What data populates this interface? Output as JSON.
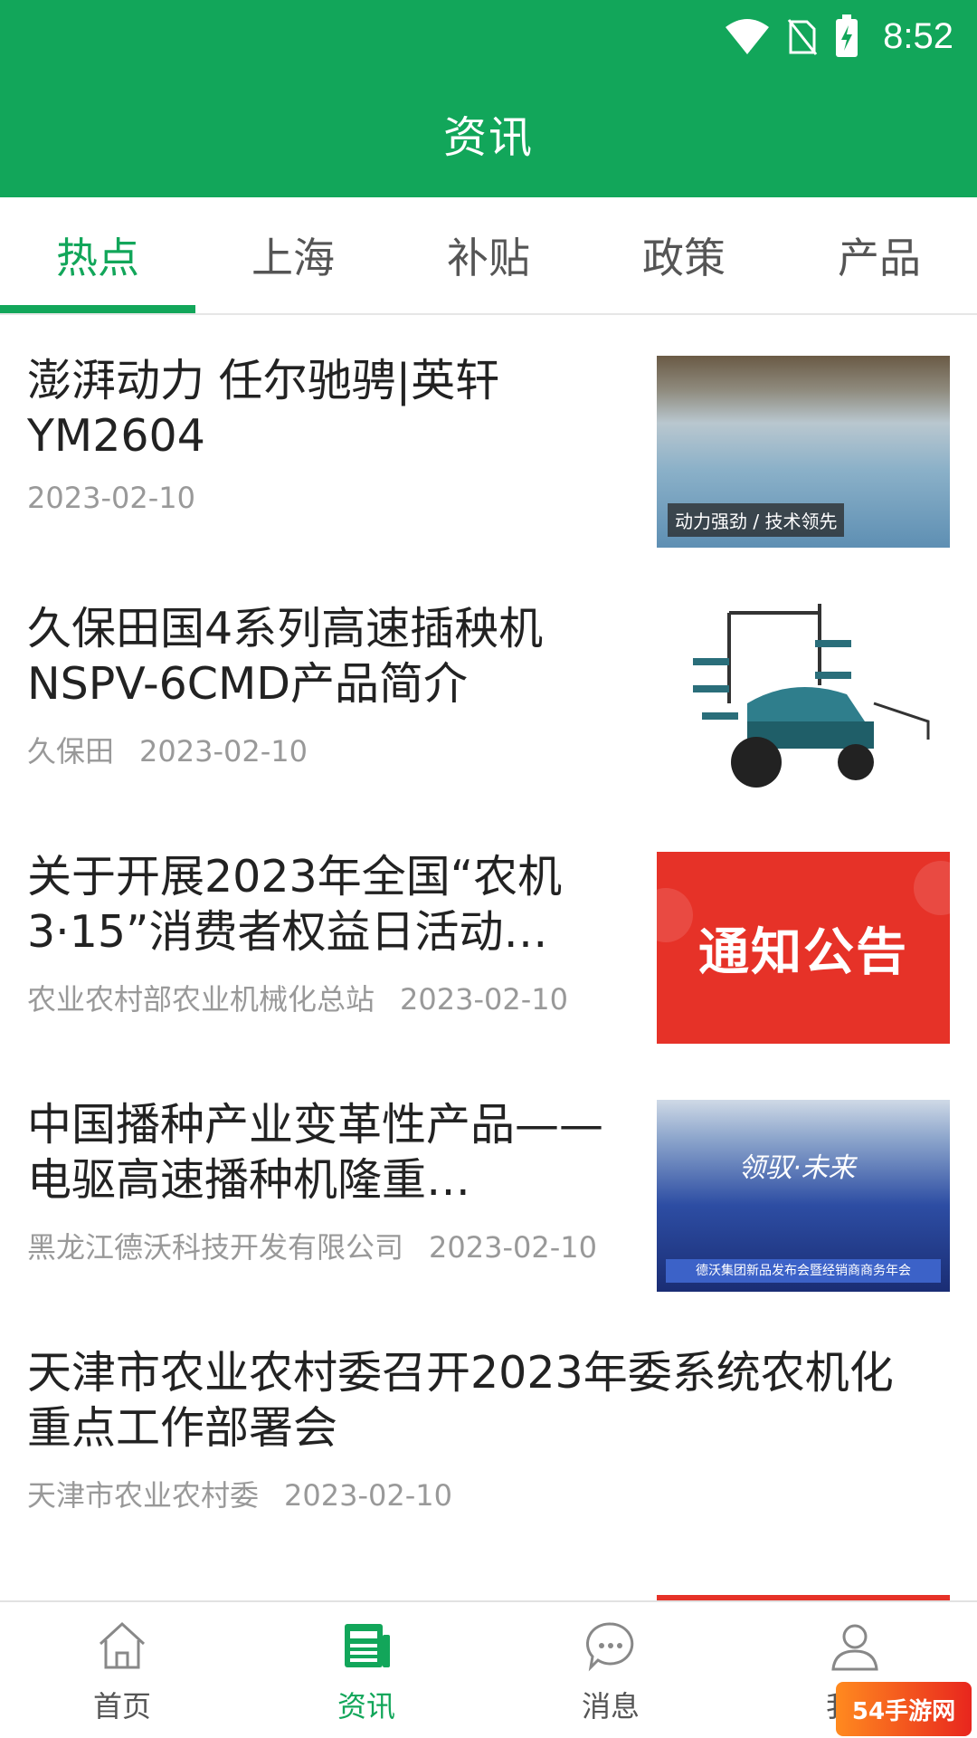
{
  "status_bar": {
    "time": "8:52",
    "icons": [
      "wifi-icon",
      "no-sim-icon",
      "battery-charging-icon"
    ]
  },
  "header": {
    "title": "资讯"
  },
  "tabs": [
    {
      "label": "热点",
      "active": true
    },
    {
      "label": "上海",
      "active": false
    },
    {
      "label": "补贴",
      "active": false
    },
    {
      "label": "政策",
      "active": false
    },
    {
      "label": "产品",
      "active": false
    }
  ],
  "news": [
    {
      "title": "澎湃动力 任尔驰骋|英轩YM2604",
      "source": "",
      "date": "2023-02-10",
      "thumb_caption": "动力强劲 / 技术领先"
    },
    {
      "title": "久保田国4系列高速插秧机NSPV-6CMD产品简介",
      "source": "久保田",
      "date": "2023-02-10"
    },
    {
      "title": "关于开展2023年全国“农机3·15”消费者权益日活动…",
      "source": "农业农村部农业机械化总站",
      "date": "2023-02-10",
      "thumb_text": "通知公告"
    },
    {
      "title": "中国播种产业变革性产品——电驱高速播种机隆重…",
      "source": "黑龙江德沃科技开发有限公司",
      "date": "2023-02-10",
      "thumb_script": "领驭·未来",
      "thumb_banner": "德沃集团新品发布会暨经销商商务年会"
    },
    {
      "title": "天津市农业农村委召开2023年委系统农机化重点工作部署会",
      "source": "天津市农业农村委",
      "date": "2023-02-10"
    }
  ],
  "bottom_nav": [
    {
      "label": "首页",
      "icon": "home-icon",
      "active": false
    },
    {
      "label": "资讯",
      "icon": "news-icon",
      "active": true
    },
    {
      "label": "消息",
      "icon": "message-icon",
      "active": false
    },
    {
      "label": "我的",
      "icon": "user-icon",
      "active": false
    }
  ],
  "watermark": {
    "text": "54手游网"
  },
  "colors": {
    "brand": "#12a65a",
    "notice_red": "#e63228"
  }
}
